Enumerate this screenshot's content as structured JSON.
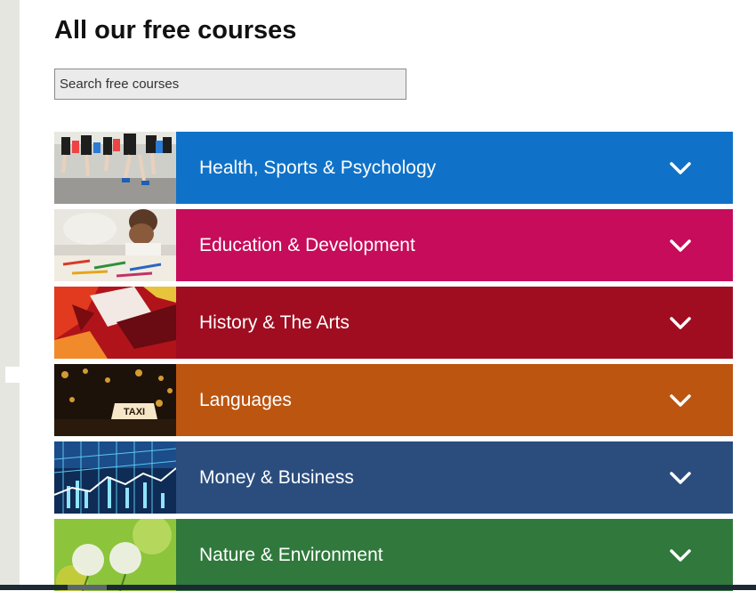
{
  "page": {
    "title": "All our free courses"
  },
  "search": {
    "placeholder": "Search free courses"
  },
  "categories": [
    {
      "label": "Health, Sports & Psychology",
      "color": "#0f72c8",
      "image": "runners-photo"
    },
    {
      "label": "Education & Development",
      "color": "#c60c5a",
      "image": "child-drawing-photo"
    },
    {
      "label": "History & The Arts",
      "color": "#a00d20",
      "image": "abstract-painting-photo"
    },
    {
      "label": "Languages",
      "color": "#bb5510",
      "image": "paris-taxi-photo"
    },
    {
      "label": "Money & Business",
      "color": "#2b4d7e",
      "image": "stock-data-photo"
    },
    {
      "label": "Nature & Environment",
      "color": "#30783c",
      "image": "dandelion-photo"
    }
  ]
}
